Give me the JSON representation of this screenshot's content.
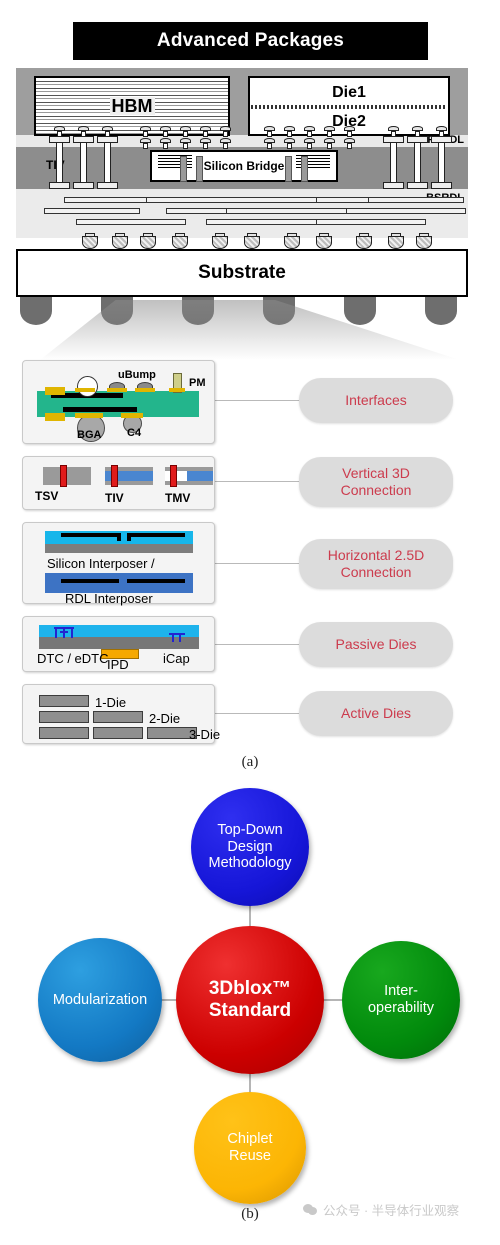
{
  "figure": {
    "caption_a": "(a)",
    "caption_b": "(b)"
  },
  "package": {
    "title": "Advanced Packages",
    "hbm_label": "HBM",
    "die1_label": "Die1",
    "die2_label": "Die2",
    "fsrdl_label": "FSRDL",
    "bsrdl_label": "BSRDL",
    "tiv_label": "TIV",
    "tsv_label": "TSV",
    "bridge_label": "Silicon Bridge",
    "substrate_label": "Substrate"
  },
  "legend": {
    "rows": [
      {
        "pill": "Interfaces",
        "parts": [
          "uBump",
          "PM",
          "BGA",
          "C4"
        ]
      },
      {
        "pill": "Vertical 3D\nConnection",
        "pill_line1": "Vertical 3D",
        "pill_line2": "Connection",
        "parts": [
          "TSV",
          "TIV",
          "TMV"
        ]
      },
      {
        "pill": "Horizontal 2.5D\nConnection",
        "pill_line1": "Horizontal 2.5D",
        "pill_line2": "Connection",
        "parts": [
          "Silicon Interposer /",
          "RDL Interposer"
        ]
      },
      {
        "pill": "Passive Dies",
        "parts": [
          "DTC / eDTC",
          "IPD",
          "iCap"
        ]
      },
      {
        "pill": "Active Dies",
        "parts": [
          "1-Die",
          "2-Die",
          "3-Die"
        ]
      }
    ]
  },
  "wheel": {
    "center": {
      "line1": "3Dblox™",
      "line2": "Standard",
      "color": "#cc0000"
    },
    "top": {
      "line1": "Top-Down",
      "line2": "Design",
      "line3": "Methodology",
      "color": "#1616d8"
    },
    "left": {
      "line1": "Modularization",
      "color": "#1379c4"
    },
    "right": {
      "line1": "Inter-",
      "line2": "operability",
      "color": "#018a0c"
    },
    "bottom": {
      "line1": "Chiplet",
      "line2": "Reuse",
      "color": "#fcb504"
    }
  },
  "watermark": {
    "text": "公众号 · 半导体行业观察"
  }
}
